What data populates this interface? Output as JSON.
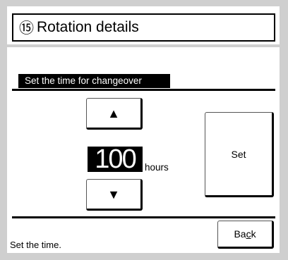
{
  "header": {
    "number_symbol": "⑮",
    "title": "Rotation details"
  },
  "section": {
    "label": "Set the time for changeover"
  },
  "stepper": {
    "up_icon": "▲",
    "down_icon": "▼",
    "value": "100",
    "unit": "hours"
  },
  "buttons": {
    "set_label": "Set",
    "back_label_pre": "Ba",
    "back_label_underlined": "c",
    "back_label_post": "k"
  },
  "status": {
    "message": "Set the time."
  },
  "colors": {
    "background": "#cfcfcf",
    "panel": "#ffffff",
    "ink": "#000000"
  }
}
